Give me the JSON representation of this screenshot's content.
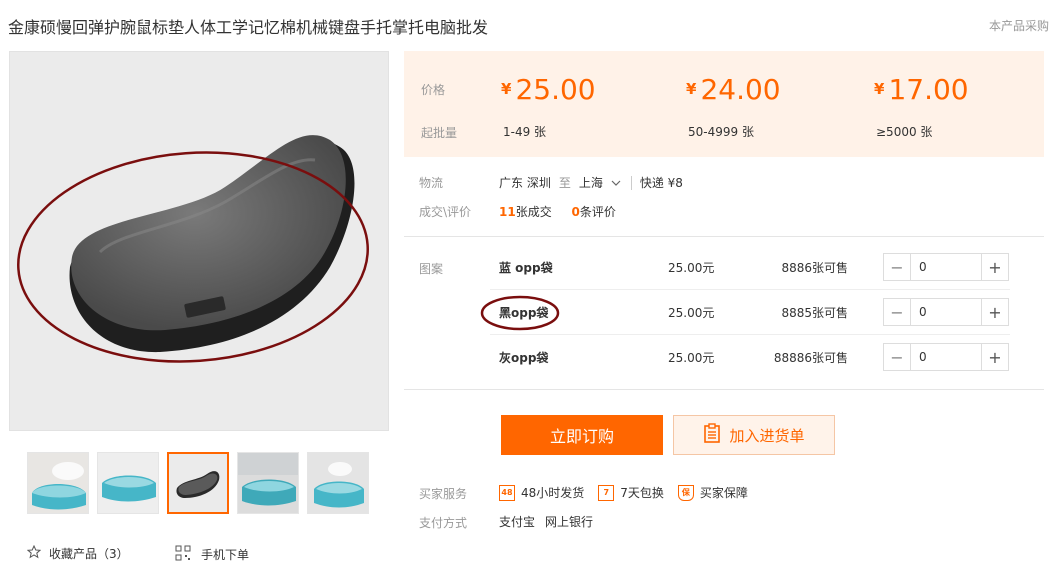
{
  "product": {
    "title": "金康硕慢回弹护腕鼠标垫人体工学记忆棉机械键盘手托掌托电脑批发",
    "top_right": "本产品采购"
  },
  "prices": {
    "price_label": "价格",
    "moq_label": "起批量",
    "currency": "¥",
    "tiers": [
      {
        "price": "25.00",
        "range": "1-49 张"
      },
      {
        "price": "24.00",
        "range": "50-4999 张"
      },
      {
        "price": "17.00",
        "range": "≥5000 张"
      }
    ]
  },
  "logistics": {
    "label": "物流",
    "from": "广东 深圳",
    "to_word": "至",
    "to": "上海",
    "shipping": "快递 ¥8"
  },
  "deals": {
    "label": "成交\\评价",
    "sold_count": "11",
    "sold_text": "张成交",
    "review_count": "0",
    "review_text": "条评价"
  },
  "skus": {
    "label": "图案",
    "items": [
      {
        "name": "蓝 opp袋",
        "price": "25.00元",
        "stock": "8886张可售",
        "qty": "0"
      },
      {
        "name": "黑opp袋",
        "price": "25.00元",
        "stock": "8885张可售",
        "qty": "0"
      },
      {
        "name": "灰opp袋",
        "price": "25.00元",
        "stock": "88886张可售",
        "qty": "0"
      }
    ]
  },
  "actions": {
    "buy": "立即订购",
    "cart": "加入进货单"
  },
  "services": {
    "label": "买家服务",
    "items": [
      {
        "icon": "48",
        "text": "48小时发货"
      },
      {
        "icon": "7",
        "text": "7天包换"
      },
      {
        "icon": "保",
        "text": "买家保障"
      }
    ]
  },
  "payment": {
    "label": "支付方式",
    "methods": [
      "支付宝",
      "网上银行"
    ]
  },
  "gallery": {
    "fav_label": "收藏产品（3）",
    "mobile_label": "手机下单"
  },
  "colors": {
    "accent": "#ff6600",
    "annotation": "#7a0e0e"
  }
}
